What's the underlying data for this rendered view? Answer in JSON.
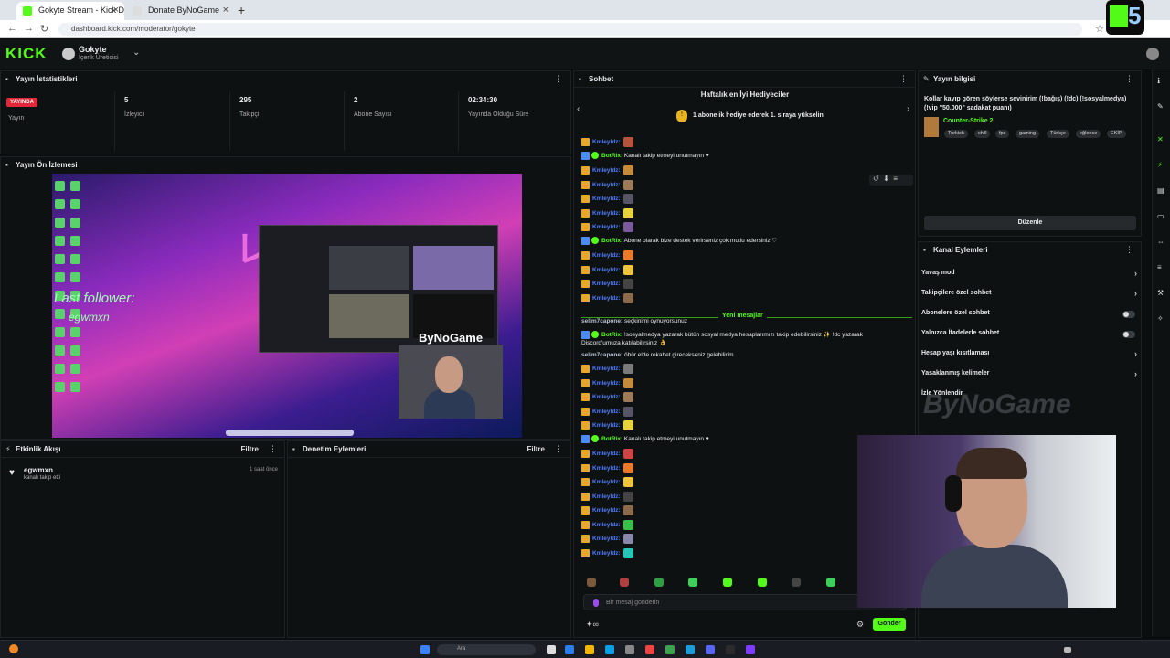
{
  "browser": {
    "tabs": [
      {
        "title": "Gokyte Stream - Kick Dashboo",
        "active": true
      },
      {
        "title": "Donate ByNoGame",
        "active": false
      }
    ],
    "url": "dashboard.kick.com/moderator/gokyte",
    "extension_badge": "5"
  },
  "header": {
    "logo": "KICK",
    "channel_name": "Gokyte",
    "channel_role": "İçerik Üreticisi"
  },
  "stats": {
    "title": "Yayın İstatistikleri",
    "live_badge": "YAYINDA",
    "live_label": "Yayın",
    "viewers_value": "5",
    "viewers_label": "İzleyici",
    "followers_value": "295",
    "followers_label": "Takipçi",
    "subs_value": "2",
    "subs_label": "Abone Sayısı",
    "uptime_value": "02:34:30",
    "uptime_label": "Yayında Olduğu Süre"
  },
  "preview": {
    "title": "Yayın Ön İzlemesi",
    "overlay_follow": "Last follower:",
    "overlay_follow_name": "egwmxn",
    "overlay_brand": "ByNoGame"
  },
  "activity": {
    "title": "Etkinlik Akışı",
    "filter": "Filtre",
    "items": [
      {
        "name": "egwmxn",
        "action": "kanalı takip etti",
        "time": "1 saat önce"
      }
    ]
  },
  "moderation": {
    "title": "Denetim Eylemleri",
    "filter": "Filtre"
  },
  "chat": {
    "title": "Sohbet",
    "gifters_title": "Haftalık en İyi Hediyeciler",
    "gifters_prompt": "1 abonelik hediye ederek 1. sıraya yükselin",
    "new_messages": "Yeni mesajlar",
    "placeholder": "Bir mesaj gönderin",
    "send": "Gönder",
    "messages": [
      {
        "type": "user",
        "name": "Kmleyldz:",
        "text": ""
      },
      {
        "type": "bot",
        "name": "BotRix:",
        "text": "Kanalı takip etmeyi unutmayın ♥"
      },
      {
        "type": "user",
        "name": "Kmleyldz:",
        "text": ""
      },
      {
        "type": "user",
        "name": "Kmleyldz:",
        "text": ""
      },
      {
        "type": "user",
        "name": "Kmleyldz:",
        "text": ""
      },
      {
        "type": "user",
        "name": "Kmleyldz:",
        "text": ""
      },
      {
        "type": "user",
        "name": "Kmleyldz:",
        "text": ""
      },
      {
        "type": "bot",
        "name": "BotRix:",
        "text": "Abone olarak bize destek verirseniz çok mutlu edersiniz ♡"
      },
      {
        "type": "user",
        "name": "Kmleyldz:",
        "text": ""
      },
      {
        "type": "user",
        "name": "Kmleyldz:",
        "text": ""
      },
      {
        "type": "user",
        "name": "Kmleyldz:",
        "text": ""
      },
      {
        "type": "user",
        "name": "Kmleyldz:",
        "text": ""
      },
      {
        "type": "sel",
        "name": "selim7capone:",
        "text": "seçkinimi oynuyorsunuz"
      },
      {
        "type": "bot",
        "name": "BotRix:",
        "text": "!sosyalmedya yazarak bütün sosyal medya hesaplarımızı takip edebilirsiniz ✨ !dc yazarak"
      },
      {
        "type": "cont",
        "name": "",
        "text": "Discord'umuza katılabilirsiniz 👌"
      },
      {
        "type": "sel",
        "name": "selim7capone:",
        "text": "öbür elde rekabet girecekseniz gelebilirim"
      },
      {
        "type": "user",
        "name": "Kmleyldz:",
        "text": ""
      },
      {
        "type": "user",
        "name": "Kmleyldz:",
        "text": ""
      },
      {
        "type": "user",
        "name": "Kmleyldz:",
        "text": ""
      },
      {
        "type": "user",
        "name": "Kmleyldz:",
        "text": ""
      },
      {
        "type": "user",
        "name": "Kmleyldz:",
        "text": ""
      },
      {
        "type": "bot",
        "name": "BotRix:",
        "text": "Kanalı takip etmeyi unutmayın ♥"
      },
      {
        "type": "user",
        "name": "Kmleyldz:",
        "text": ""
      },
      {
        "type": "user",
        "name": "Kmleyldz:",
        "text": ""
      },
      {
        "type": "user",
        "name": "Kmleyldz:",
        "text": ""
      },
      {
        "type": "user",
        "name": "Kmleyldz:",
        "text": ""
      },
      {
        "type": "user",
        "name": "Kmleyldz:",
        "text": ""
      },
      {
        "type": "user",
        "name": "Kmleyldz:",
        "text": ""
      },
      {
        "type": "user",
        "name": "Kmleyldz:",
        "text": ""
      },
      {
        "type": "user",
        "name": "Kmleyldz:",
        "text": ""
      }
    ]
  },
  "stream_info": {
    "title": "Yayın bilgisi",
    "stream_title": "Kollar kayıp gören söylerse sevinirim (!bağış) (!dc) (!sosyalmedya) (!vip \"50.000\" sadakat puanı)",
    "category": "Counter-Strike 2",
    "tags": [
      "Turkish",
      "chill",
      "fps",
      "gaming",
      "Türkçe",
      "eğlence",
      "EKİP"
    ],
    "edit": "Düzenle"
  },
  "channel_actions": {
    "title": "Kanal Eylemleri",
    "items": [
      {
        "label": "Yavaş mod",
        "control": "chevron"
      },
      {
        "label": "Takipçilere özel sohbet",
        "control": "chevron"
      },
      {
        "label": "Abonelere özel sohbet",
        "control": "toggle"
      },
      {
        "label": "Yalnızca İfadelerle sohbet",
        "control": "toggle"
      },
      {
        "label": "Hesap yaşı kısıtlaması",
        "control": "chevron"
      },
      {
        "label": "Yasaklanmış kelimeler",
        "control": "chevron"
      },
      {
        "label": "İzle Yönlendir",
        "control": "none"
      }
    ],
    "watermark": "ByNoGame"
  },
  "taskbar": {
    "search": "Ara"
  },
  "colors": {
    "accent": "#53fc18",
    "live": "#e2283a",
    "username": "#4f7cff"
  }
}
